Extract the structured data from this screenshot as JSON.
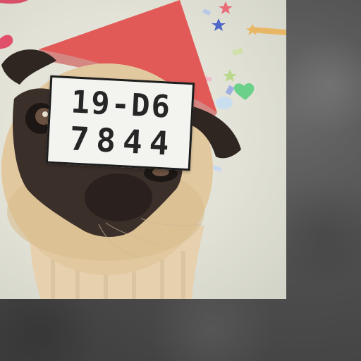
{
  "plate": {
    "line1": "19-D6",
    "line2": "7844"
  },
  "colors": {
    "backdrop": "#4e4e4e",
    "photo_background": "#e4e4da",
    "party_hat": "#e25252",
    "pug_fur": "#e2c89e",
    "pug_mask": "#3b2f2a",
    "plate_background": "#f3f3f0",
    "plate_text": "#262626"
  },
  "icons": [
    "party-hat",
    "star",
    "heart",
    "confetti"
  ]
}
